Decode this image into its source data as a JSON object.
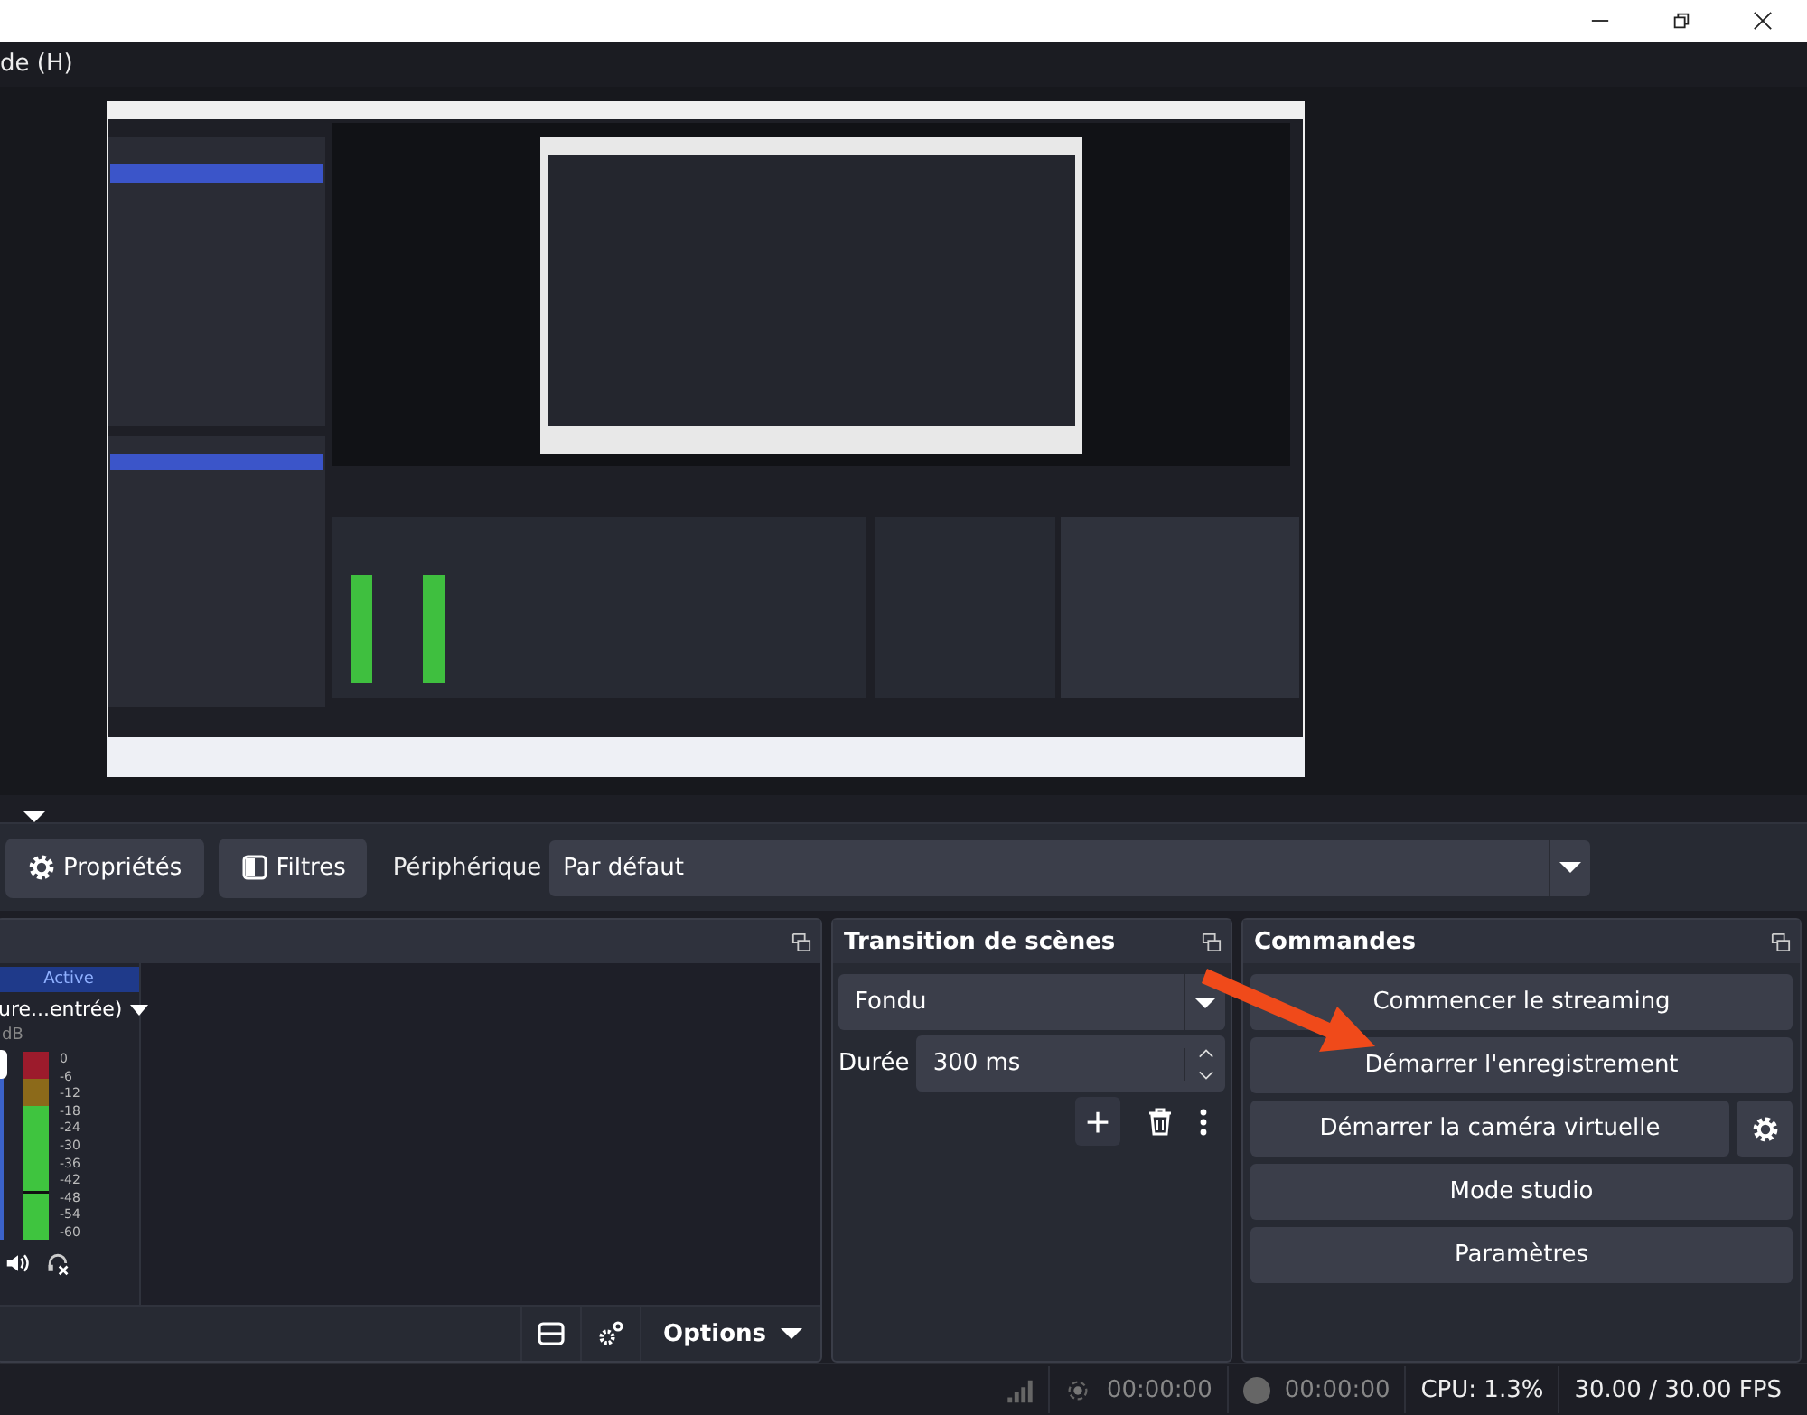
{
  "window": {
    "menu_fragment": "de (H)"
  },
  "source_toolbar": {
    "properties": "Propriétés",
    "filters": "Filtres",
    "device_label": "Périphérique",
    "device_value": "Par défaut"
  },
  "audio_mixer": {
    "channel": {
      "status": "Active",
      "name": "ure...entrée)",
      "volume": "dB",
      "level": 0.93,
      "scale": [
        "0",
        "-6",
        "-12",
        "-18",
        "-24",
        "-30",
        "-36",
        "-42",
        "-48",
        "-54",
        "-60"
      ]
    },
    "options": "Options"
  },
  "transitions": {
    "title": "Transition de scènes",
    "transition": "Fondu",
    "duration_label": "Durée",
    "duration": "300 ms"
  },
  "controls": {
    "title": "Commandes",
    "buttons": [
      {
        "label": "Commencer le streaming",
        "kind": "plain"
      },
      {
        "label": "Démarrer l'enregistrement",
        "kind": "plain"
      },
      {
        "label": "Démarrer la caméra virtuelle",
        "kind": "with-settings"
      },
      {
        "label": "Mode studio",
        "kind": "plain"
      },
      {
        "label": "Paramètres",
        "kind": "plain"
      }
    ]
  },
  "status_bar": {
    "stream_time": "00:00:00",
    "record_time": "00:00:00",
    "cpu": "CPU: 1.3%",
    "fps": "30.00 / 30.00 FPS"
  }
}
